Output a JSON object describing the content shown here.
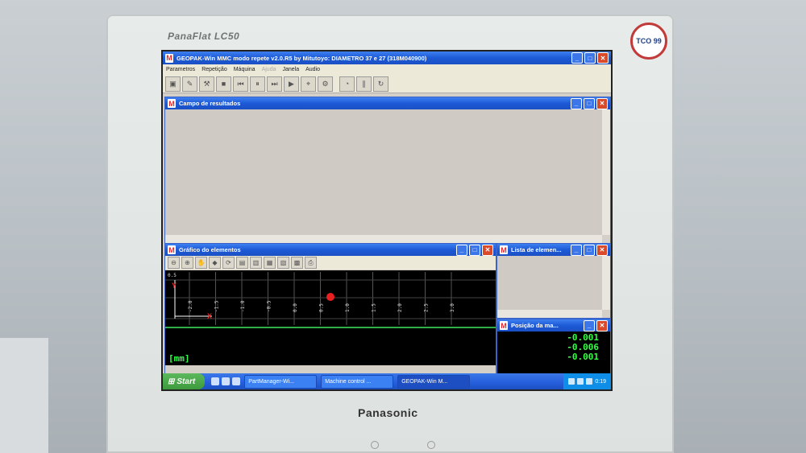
{
  "monitor": {
    "model": "PanaFlat LC50",
    "brand": "Panasonic",
    "badge": "TCO 99"
  },
  "main_window": {
    "title": "GEOPAK-Win MMC modo repete  v2.0.R5  by Mitutoyo: DIAMETRO 37 e 27 (318M040900)"
  },
  "menu": [
    {
      "label": "Parametros",
      "enabled": true
    },
    {
      "label": "Repetição",
      "enabled": true
    },
    {
      "label": "Máquina",
      "enabled": true
    },
    {
      "label": "Ajuda",
      "enabled": false
    },
    {
      "label": "Janela",
      "enabled": true
    },
    {
      "label": "Audio",
      "enabled": true
    }
  ],
  "results_panel": {
    "title": "Campo de resultados"
  },
  "graph_panel": {
    "title": "Gráfico do elementos",
    "units": "[mm]",
    "axis_top": "0.5",
    "ticks": [
      "-2.0",
      "-1.5",
      "-1.0",
      "-0.5",
      "0.0",
      "0.5",
      "1.0",
      "1.5",
      "2.0",
      "2.5",
      "3.0"
    ]
  },
  "list_panel": {
    "title": "Lista de elemen..."
  },
  "position_panel": {
    "title": "Posição da ma...",
    "values": [
      "-0.001",
      "-0.006",
      "-0.001"
    ]
  },
  "taskbar": {
    "start_label": "Start",
    "tasks": [
      "PartManager-Wi...",
      "Machine control ...",
      "GEOPAK-Win M..."
    ],
    "clock": "0:19"
  }
}
